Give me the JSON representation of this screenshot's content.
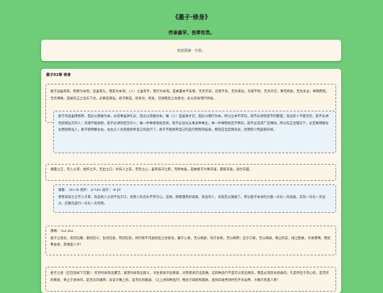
{
  "header": {
    "title": "《墨子·修身》",
    "subtitle": "传承墨学，吾辈有责。"
  },
  "welcome": {
    "text": "欢迎阅读 · 分享。"
  },
  "chapter": {
    "title": "墨子02章 修身"
  },
  "sections": [
    {
      "original": "君子战虽有陈，而勇为本焉；丧虽有礼，而哀为本焉；（人）士虽有学，而行为本焉。是故置本不安者，无务丰末；近者不亲，无务来远；亲戚不附，无务外交；事无终始，无务多业；举物而暗，无务博闻。是故先王之治天下也，必察迩来远。君子察迩，修身也；修身，见毁而反之身者也，此以怨省而行修矣。",
      "translation": "君子作战虽用阵势，但必以勇敢为本。办丧事虽讲礼仪，但必以哀痛为本。做（人）官虽讲才识，但必以德行为本。所以立本不牢的，就不必讲究枝节的繁盛；身边的人不能亲近，就不必讲究招徕远方的人；亲戚不能依附，就不必讲究结交外人；做一件事情有始无终，就不必谈论从事多种事业；举一件事物尚且不明白，就不必追求广见博闻。所以先王治理天下，必定要明察左右而招徕远人。君子能明察左右，左右之人也就能修养自己的品行了。君子不能修养自己的品行而受到诋毁，那就应当自我反省，因而怨少而品德日修。"
    },
    {
      "original": "谮慝之言，无入之耳；批扞之声，无出之口；杀伤人之孩，无存之心，虽有诋讦之民，无所依矣。是故君子力事日强，愿欲日逾，设壮日盛。",
      "note": "谮慝： zèn tè  批扞： pī hàn  诋讦： dǐ jié",
      "translation": "谗害诽谤之言不入于耳，攻击他人之语不出于口，伤害人的念头不存于心。这样，即使遇有好诋毁、攻击的人，也就无从施展了。所以君子本身的力量一天比一天加强，志向一天比一天远大，庄敬的品行一天比一天完善。"
    },
    {
      "note": "隳晦： huī dùn",
      "original": "君子之道也，贫则见廉，富则见义，生则见爱，死则见哀，四行者不可虚假反之身者也。藏于心者，无以竭爱；动于身者，无以竭恭；出于口者，无以竭驯。畅之四支，接之肌肤，华发隳晦，而犹弗舍者，其唯圣人乎！"
    },
    {
      "translation": "君子之道（应包括如下方面）：贫穷时表现出廉洁，富足时表现出恩义，对生者表示出慈爱，对死者表示出哀痛。这四种品行不是可以装出来的，而是必须反身具备的。凡是存在于内心的，是无穷的慈爱；举止于身体的，是无比的谦恭；谈说于嘴上的，是无比的雅驯。（让上述四种品行）畅达于四肢和肌肤，直到白发秃顶时仍不肯舍弃，大概只有圣人吧！"
    }
  ]
}
